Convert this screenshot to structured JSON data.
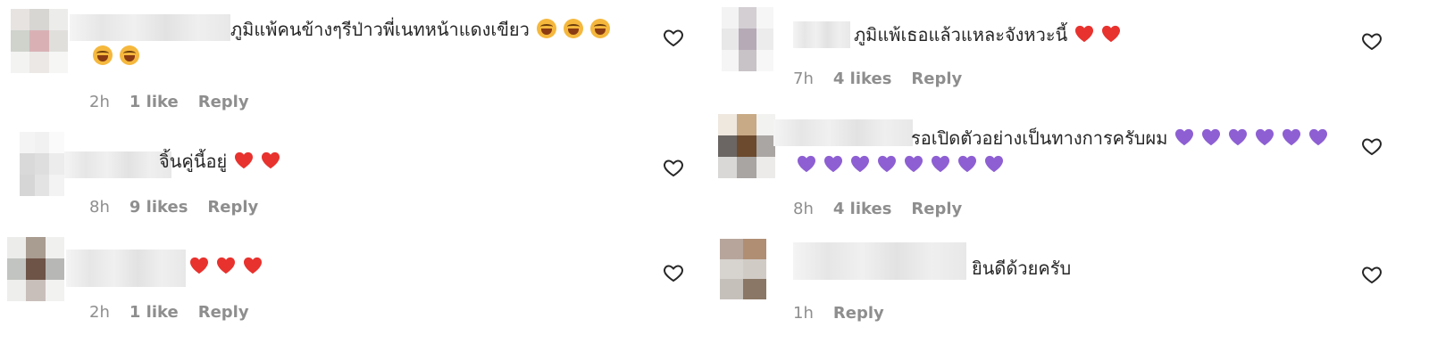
{
  "colors": {
    "red_heart": "#e8322e",
    "purple_heart": "#8d5fd3",
    "laugh_emoji": "#f5b83d",
    "meta_gray": "#8e8e8e",
    "text": "#262626"
  },
  "comments": [
    {
      "text": "ภูมิแพ้คนข้างๆรีป่าวพี่เนทหน้าแดงเขียว",
      "emoji": "laughing-crying",
      "time": "2h",
      "likes": "1 like",
      "reply": "Reply"
    },
    {
      "text": "จิ้นคู่นี้อยู่",
      "emoji": "red-heart",
      "time": "8h",
      "likes": "9 likes",
      "reply": "Reply"
    },
    {
      "text": "",
      "emoji": "red-heart",
      "time": "2h",
      "likes": "1 like",
      "reply": "Reply"
    },
    {
      "text": "ภูมิแพ้เธอแล้วแหละจังหวะนี้",
      "emoji": "red-heart",
      "time": "7h",
      "likes": "4 likes",
      "reply": "Reply"
    },
    {
      "text": "รอเปิดตัวอย่างเป็นทางการครับผม",
      "emoji": "purple-heart",
      "time": "8h",
      "likes": "4 likes",
      "reply": "Reply"
    },
    {
      "text": "ยินดีด้วยครับ",
      "emoji": "",
      "time": "1h",
      "likes": "",
      "reply": "Reply"
    }
  ]
}
